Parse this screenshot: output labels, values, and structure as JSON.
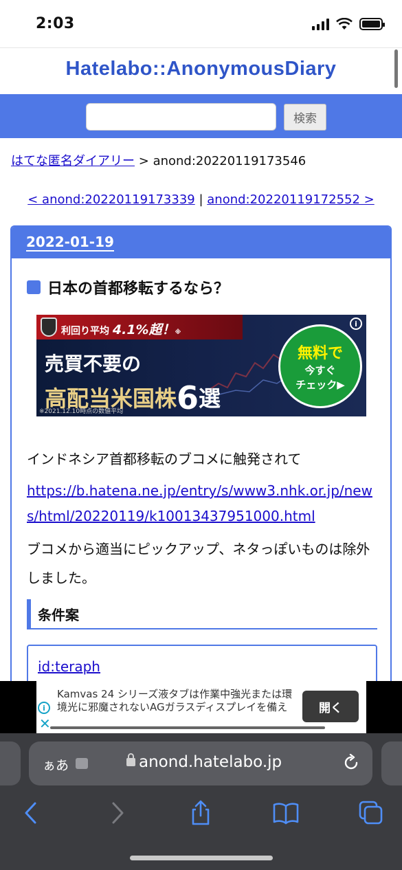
{
  "status": {
    "time": "2:03"
  },
  "site": {
    "title": "Hatelabo::AnonymousDiary"
  },
  "search": {
    "button": "検索",
    "placeholder": ""
  },
  "breadcrumb": {
    "home": "はてな匿名ダイアリー",
    "separator": ">",
    "current": "anond:20220119173546"
  },
  "pager": {
    "prev": "< anond:20220119173339",
    "sep": " | ",
    "next": "anond:20220119172552 >"
  },
  "day": {
    "date": "2022-01-19"
  },
  "entry": {
    "title": "日本の首都移転するなら？",
    "para1": "インドネシア首都移転のブコメに触発されて",
    "link": "https://b.hatena.ne.jp/entry/s/www3.nhk.or.jp/news/html/20220119/k10013437951000.html",
    "para2": "ブコメから適当にピックアップ、ネタっぽいものは除外しました。",
    "section_heading": "条件案",
    "comment_user": "id:teraph"
  },
  "ad": {
    "top_prefix": "利回り平均",
    "top_value": "4.1%超！",
    "top_mark": "※",
    "line1": "売買不要の",
    "line2": "高配当米国株",
    "line2_big": "6",
    "line2_suffix": "選",
    "note": "※2021.12.10時点の数値平均",
    "circle1": "無料で",
    "circle2": "今すぐ",
    "circle3": "チェック▶",
    "info": "i"
  },
  "banner": {
    "text": "Kamvas 24 シリーズ液タブは作業中強光または環境光に邪魔されないAGガラスディスプレイを備え",
    "open": "開く",
    "info": "i",
    "close": "✕"
  },
  "browser": {
    "aa": "ぁあ",
    "host": "anond.hatelabo.jp"
  },
  "colors": {
    "accent": "#4f78e6",
    "title": "#2f55c8",
    "link": "#1a0dcc",
    "chrome": "#3b3c40"
  }
}
